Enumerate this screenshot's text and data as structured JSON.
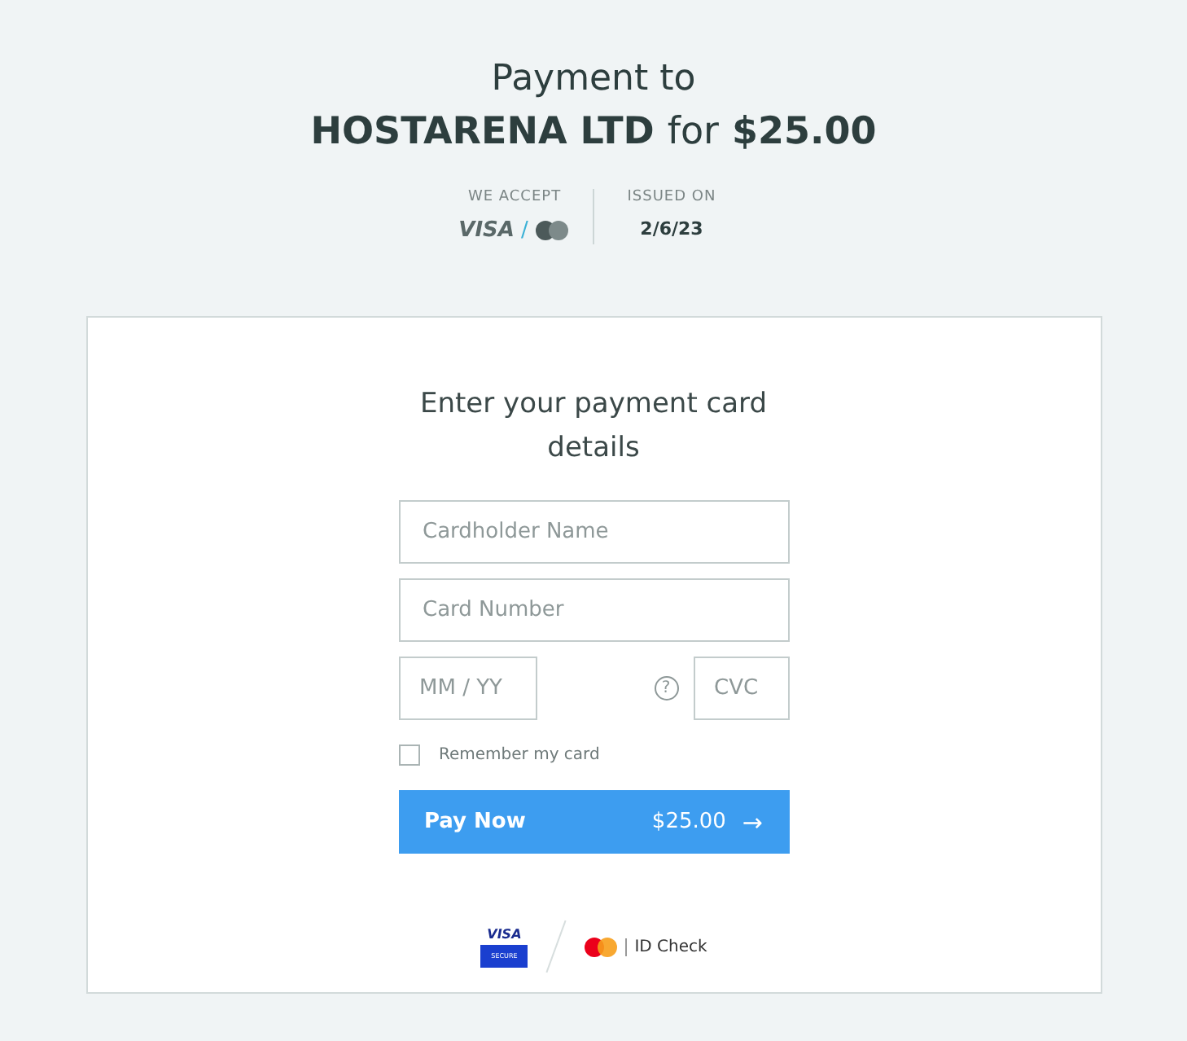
{
  "header": {
    "line1": "Payment to",
    "merchant": "HOSTARENA LTD",
    "joiner": "for",
    "amount": "$25.00"
  },
  "meta": {
    "accept_label": "WE ACCEPT",
    "accept_brand": "VISA",
    "accept_separator": "/",
    "issued_label": "ISSUED ON",
    "issued_date": "2/6/23"
  },
  "form": {
    "title": "Enter your payment card details",
    "fields": [
      {
        "placeholder": "Cardholder Name"
      },
      {
        "placeholder": "Card Number"
      }
    ],
    "expiry": {
      "placeholder": "MM / YY"
    },
    "help": "?",
    "cvc": {
      "placeholder": "CVC"
    },
    "remember": {
      "label": "Remember my card",
      "checked": false
    },
    "pay_button": {
      "label": "Pay Now",
      "amount": "$25.00",
      "arrow": "→"
    }
  },
  "footer": {
    "visa_word": "VISA",
    "visa_secure": "SECURE",
    "id_check": "ID Check"
  }
}
